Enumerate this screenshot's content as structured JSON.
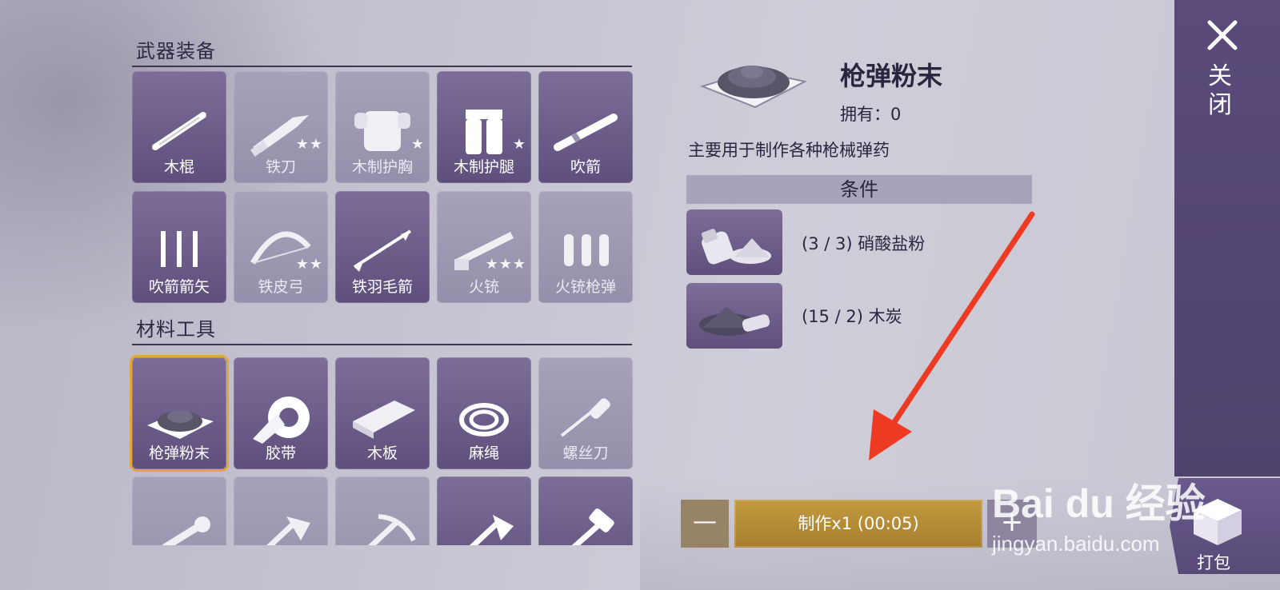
{
  "sections": {
    "weapons_title": "武器装备",
    "materials_title": "材料工具"
  },
  "weapons": [
    {
      "label": "木棍",
      "locked": false,
      "stars": 0,
      "icon": "stick-icon"
    },
    {
      "label": "铁刀",
      "locked": true,
      "stars": 2,
      "icon": "knife-icon"
    },
    {
      "label": "木制护胸",
      "locked": true,
      "stars": 1,
      "icon": "chest-armor-icon"
    },
    {
      "label": "木制护腿",
      "locked": false,
      "stars": 1,
      "icon": "leg-armor-icon"
    },
    {
      "label": "吹箭",
      "locked": false,
      "stars": 0,
      "icon": "blowgun-icon"
    },
    {
      "label": "吹箭箭矢",
      "locked": false,
      "stars": 0,
      "icon": "darts-icon"
    },
    {
      "label": "铁皮弓",
      "locked": true,
      "stars": 2,
      "icon": "bow-icon"
    },
    {
      "label": "铁羽毛箭",
      "locked": false,
      "stars": 0,
      "icon": "arrow-icon"
    },
    {
      "label": "火铳",
      "locked": true,
      "stars": 3,
      "icon": "musket-icon"
    },
    {
      "label": "火铳枪弹",
      "locked": true,
      "stars": 0,
      "icon": "bullets-icon"
    }
  ],
  "materials": [
    {
      "label": "枪弹粉末",
      "locked": false,
      "selected": true,
      "icon": "powder-icon"
    },
    {
      "label": "胶带",
      "locked": false,
      "icon": "tape-icon"
    },
    {
      "label": "木板",
      "locked": false,
      "icon": "plank-icon"
    },
    {
      "label": "麻绳",
      "locked": false,
      "icon": "rope-icon"
    },
    {
      "label": "螺丝刀",
      "locked": true,
      "icon": "screwdriver-icon"
    }
  ],
  "tools_row": [
    {
      "locked": true,
      "icon": "wrench-icon"
    },
    {
      "locked": true,
      "icon": "axe-icon"
    },
    {
      "locked": true,
      "icon": "pickaxe-icon"
    },
    {
      "locked": false,
      "icon": "stone-axe-icon"
    },
    {
      "locked": false,
      "icon": "hammer-icon"
    }
  ],
  "detail": {
    "title": "枪弹粉末",
    "owned": "拥有：0",
    "description": "主要用于制作各种枪械弹药",
    "conditions_header": "条件",
    "requirements": [
      {
        "text": "(3 / 3) 硝酸盐粉",
        "icon": "nitrate-powder-icon"
      },
      {
        "text": "(15 / 2) 木炭",
        "icon": "charcoal-icon"
      }
    ]
  },
  "craft": {
    "minus": "—",
    "make_label": "制作x1 (00:05)",
    "plus": "+"
  },
  "side": {
    "close_label": "关闭",
    "pack_label": "打包"
  },
  "watermark": {
    "brand": "Bai du 经验",
    "url": "jingyan.baidu.com"
  },
  "colors": {
    "tile_unlocked": "#6b5b8a",
    "tile_locked": "#9e98b2",
    "selected_border": "#e3a63a",
    "craft_button": "#b58c36",
    "annotation_arrow": "#ee3a22"
  }
}
